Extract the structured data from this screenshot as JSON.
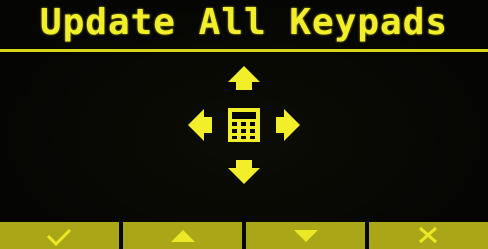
{
  "header": {
    "title": "Update All Keypads"
  },
  "navigation_graphic": {
    "directions": [
      "up",
      "left",
      "right",
      "down"
    ],
    "center_icon": "keypad-icon"
  },
  "softkeys": [
    {
      "icon": "check-icon"
    },
    {
      "icon": "arrow-up-icon"
    },
    {
      "icon": "arrow-down-icon"
    },
    {
      "icon": "cross-icon"
    }
  ],
  "colors": {
    "display_background": "#050503",
    "foreground_yellow": "#f2ef2a",
    "softkey_background": "#a9a717",
    "softkey_icon": "#ebe828"
  }
}
